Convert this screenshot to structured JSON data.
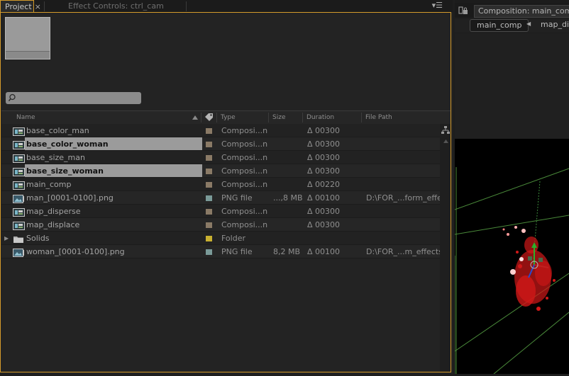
{
  "project_panel": {
    "tab_label": "Project",
    "tab_close": "×",
    "effect_tab_label": "Effect Controls: ctrl_cam",
    "menu_glyph": "▾☰",
    "search": {
      "value": "",
      "placeholder": ""
    },
    "columns": {
      "name": "Name",
      "type": "Type",
      "size": "Size",
      "duration": "Duration",
      "file_path": "File Path"
    },
    "items": [
      {
        "name": "base_color_man",
        "icon": "composition-icon",
        "label_color": "#8a7a66",
        "type": "Composi...n",
        "size": "",
        "duration": "Δ 00300",
        "path": "",
        "selected": false
      },
      {
        "name": "base_color_woman",
        "icon": "composition-icon",
        "label_color": "#8a7a66",
        "type": "Composi...n",
        "size": "",
        "duration": "Δ 00300",
        "path": "",
        "selected": true
      },
      {
        "name": "base_size_man",
        "icon": "composition-icon",
        "label_color": "#8a7a66",
        "type": "Composi...n",
        "size": "",
        "duration": "Δ 00300",
        "path": "",
        "selected": false
      },
      {
        "name": "base_size_woman",
        "icon": "composition-icon",
        "label_color": "#8a7a66",
        "type": "Composi...n",
        "size": "",
        "duration": "Δ 00300",
        "path": "",
        "selected": true
      },
      {
        "name": "main_comp",
        "icon": "composition-icon",
        "label_color": "#8a7a66",
        "type": "Composi...n",
        "size": "",
        "duration": "Δ 00220",
        "path": "",
        "selected": false
      },
      {
        "name": "man_[0001-0100].png",
        "icon": "image-sequence-icon",
        "label_color": "#7a9a98",
        "type": "PNG file",
        "size": "...,8 MB",
        "duration": "Δ 00100",
        "path": "D:\\FOR_...form_effects",
        "selected": false
      },
      {
        "name": "map_disperse",
        "icon": "composition-icon",
        "label_color": "#8a7a66",
        "type": "Composi...n",
        "size": "",
        "duration": "Δ 00300",
        "path": "",
        "selected": false
      },
      {
        "name": "map_displace",
        "icon": "composition-icon",
        "label_color": "#8a7a66",
        "type": "Composi...n",
        "size": "",
        "duration": "Δ 00300",
        "path": "",
        "selected": false
      },
      {
        "name": "Solids",
        "icon": "folder-icon",
        "label_color": "#c8b030",
        "type": "Folder",
        "size": "",
        "duration": "",
        "path": "",
        "selected": false,
        "expandable": true
      },
      {
        "name": "woman_[0001-0100].png",
        "icon": "image-sequence-icon",
        "label_color": "#7a9a98",
        "type": "PNG file",
        "size": "8,2 MB",
        "duration": "Δ 00100",
        "path": "D:\\FOR_...m_effects\\",
        "selected": false
      }
    ]
  },
  "composition_panel": {
    "tab_label": "Composition: main_comp",
    "nav_active": "main_comp",
    "nav_next": "map_di"
  },
  "colors": {
    "panel_focus_border": "#d49b2b",
    "selection": "#9b9b9b"
  }
}
